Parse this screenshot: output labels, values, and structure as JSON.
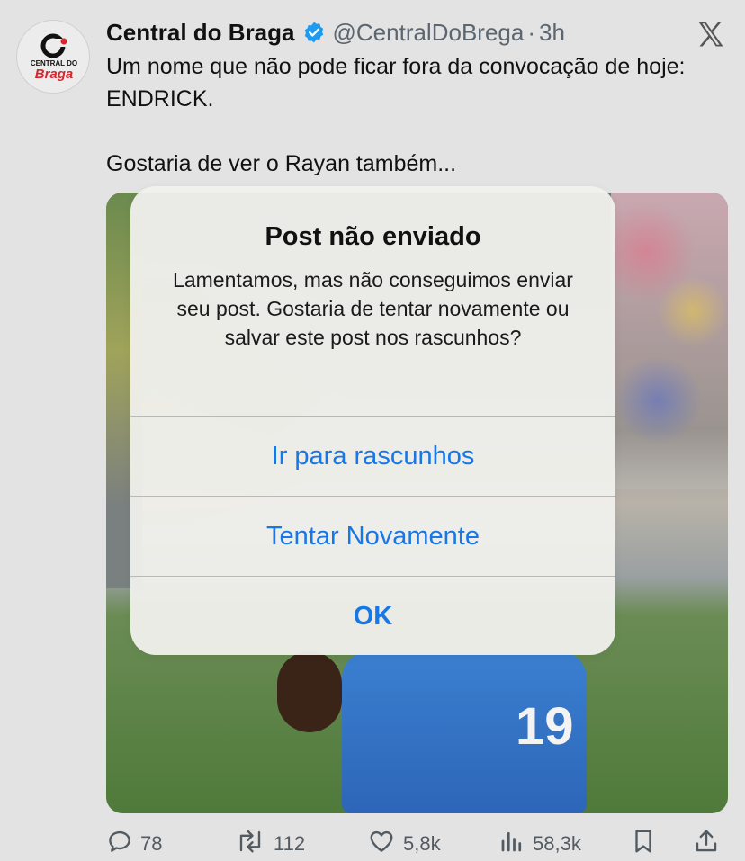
{
  "tweet": {
    "author_name": "Central do Braga",
    "handle": "@CentralDoBrega",
    "separator": "·",
    "time": "3h",
    "text_line1": "Um nome que não pode ficar fora da convocação de hoje: ENDRICK.",
    "text_line2": "Gostaria de ver o Rayan também...",
    "avatar": {
      "logo_text": "CENTRAL DO",
      "logo_brand": "Braga"
    }
  },
  "icons": {
    "verified": "verified-badge-icon",
    "x_logo": "x-logo-icon",
    "reply": "reply-icon",
    "retweet": "retweet-icon",
    "like": "like-icon",
    "views": "views-icon",
    "bookmark": "bookmark-icon",
    "share": "share-icon"
  },
  "media": {
    "jersey_number": "19"
  },
  "dialog": {
    "title": "Post não enviado",
    "message": "Lamentamos, mas não conseguimos enviar seu post. Gostaria de tentar novamente ou salvar este post nos rascunhos?",
    "buttons": {
      "drafts": "Ir para rascunhos",
      "retry": "Tentar Novamente",
      "ok": "OK"
    }
  },
  "actions": {
    "replies": "78",
    "retweets": "112",
    "likes": "5,8k",
    "views": "58,3k"
  },
  "colors": {
    "accent": "#1877e6",
    "verified": "#1d9bf0",
    "brand_red": "#d6272e"
  }
}
